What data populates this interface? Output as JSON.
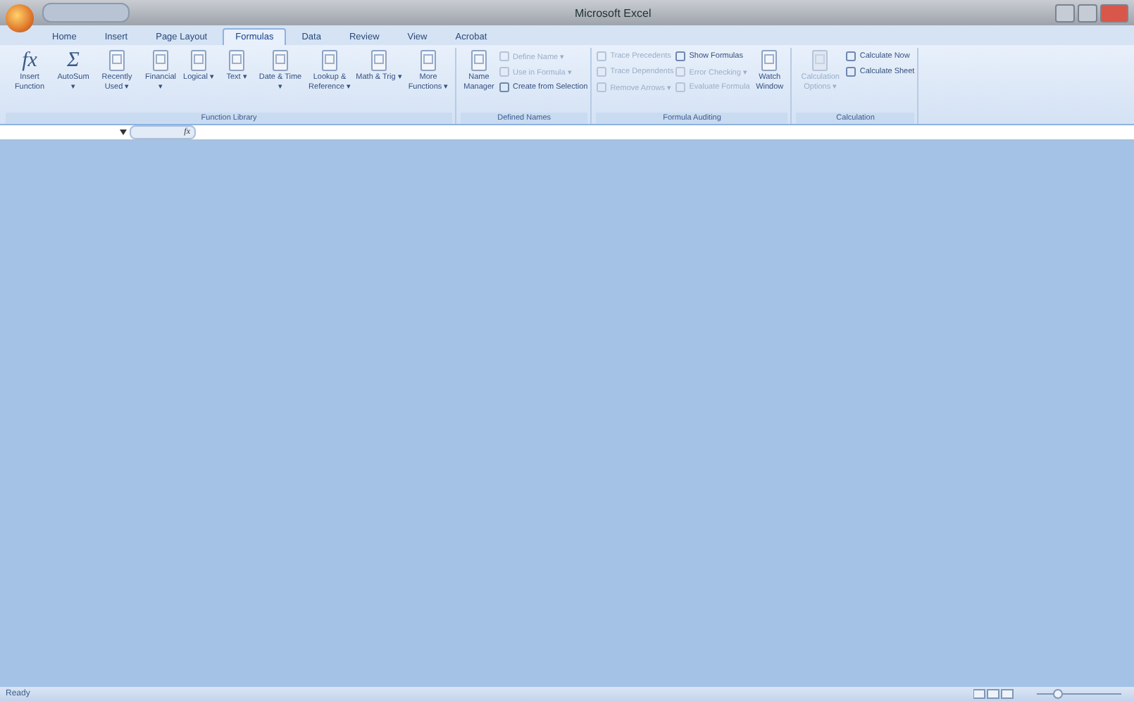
{
  "window": {
    "title": "Microsoft Excel"
  },
  "tabs": [
    {
      "label": "Home",
      "selected": false
    },
    {
      "label": "Insert",
      "selected": false
    },
    {
      "label": "Page Layout",
      "selected": false
    },
    {
      "label": "Formulas",
      "selected": true
    },
    {
      "label": "Data",
      "selected": false
    },
    {
      "label": "Review",
      "selected": false
    },
    {
      "label": "View",
      "selected": false
    },
    {
      "label": "Acrobat",
      "selected": false
    }
  ],
  "groups": [
    {
      "label": "Function Library",
      "controls": [
        {
          "kind": "large",
          "glyph": "fx",
          "label": "Insert Function",
          "disabled": false
        },
        {
          "kind": "large",
          "glyph": "Σ",
          "label": "AutoSum ▾",
          "disabled": false
        },
        {
          "kind": "large",
          "label": "Recently Used ▾",
          "disabled": false
        },
        {
          "kind": "large",
          "label": "Financial ▾",
          "disabled": false
        },
        {
          "kind": "large",
          "label": "Logical ▾",
          "disabled": false
        },
        {
          "kind": "large",
          "label": "Text ▾",
          "disabled": false
        },
        {
          "kind": "large",
          "label": "Date & Time ▾",
          "disabled": false
        },
        {
          "kind": "large",
          "label": "Lookup & Reference ▾",
          "disabled": false
        },
        {
          "kind": "large",
          "label": "Math & Trig ▾",
          "disabled": false
        },
        {
          "kind": "large",
          "label": "More Functions ▾",
          "disabled": false
        }
      ]
    },
    {
      "label": "Defined Names",
      "controls": [
        {
          "kind": "large",
          "label": "Name Manager",
          "disabled": false
        },
        {
          "kind": "stack",
          "items": [
            {
              "label": "Define Name ▾",
              "disabled": true
            },
            {
              "label": "Use in Formula ▾",
              "disabled": true
            },
            {
              "label": "Create from Selection",
              "disabled": false
            }
          ]
        }
      ]
    },
    {
      "label": "Formula Auditing",
      "controls": [
        {
          "kind": "stack",
          "items": [
            {
              "label": "Trace Precedents",
              "disabled": true
            },
            {
              "label": "Trace Dependents",
              "disabled": true
            },
            {
              "label": "Remove Arrows ▾",
              "disabled": true
            }
          ]
        },
        {
          "kind": "stack",
          "items": [
            {
              "label": "Show Formulas",
              "disabled": false
            },
            {
              "label": "Error Checking ▾",
              "disabled": true
            },
            {
              "label": "Evaluate Formula",
              "disabled": true
            }
          ]
        },
        {
          "kind": "large",
          "label": "Watch Window",
          "disabled": false
        }
      ]
    },
    {
      "label": "Calculation",
      "controls": [
        {
          "kind": "large",
          "label": "Calculation Options ▾",
          "disabled": true
        },
        {
          "kind": "stack",
          "items": [
            {
              "label": "Calculate Now",
              "disabled": false
            },
            {
              "label": "Calculate Sheet",
              "disabled": false
            }
          ]
        }
      ]
    }
  ],
  "formula_bar": {
    "function_glyph": "fx"
  },
  "status_bar": {
    "text": "Ready"
  }
}
